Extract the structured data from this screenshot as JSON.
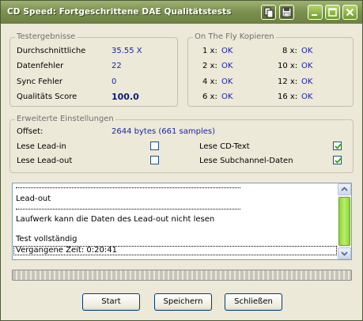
{
  "window": {
    "title": "CD Speed: Fortgeschrittene DAE Qualitätstests"
  },
  "results": {
    "legend": "Testergebnisse",
    "rows": [
      {
        "label": "Durchschnittliche",
        "value": "35.55 X"
      },
      {
        "label": "Datenfehler",
        "value": "22"
      },
      {
        "label": "Sync Fehler",
        "value": "0"
      },
      {
        "label": "Qualitäts Score",
        "value": "100.0"
      }
    ]
  },
  "onthefly": {
    "legend": "On The Fly Kopieren",
    "items": [
      {
        "speed": "1 x:",
        "status": "OK"
      },
      {
        "speed": "8 x:",
        "status": "OK"
      },
      {
        "speed": "2 x:",
        "status": "OK"
      },
      {
        "speed": "10 x:",
        "status": "OK"
      },
      {
        "speed": "4 x:",
        "status": "OK"
      },
      {
        "speed": "12 x:",
        "status": "OK"
      },
      {
        "speed": "6 x:",
        "status": "OK"
      },
      {
        "speed": "16 x:",
        "status": "OK"
      }
    ]
  },
  "advanced": {
    "legend": "Erweiterte Einstellungen",
    "offset_label": "Offset:",
    "offset_value": "2644 bytes (661 samples)",
    "options": [
      {
        "label": "Lese Lead-in",
        "checked": false
      },
      {
        "label": "Lese CD-Text",
        "checked": true
      },
      {
        "label": "Lese Lead-out",
        "checked": false
      },
      {
        "label": "Lese Subchannel-Daten",
        "checked": true
      }
    ]
  },
  "log": {
    "lines": [
      "Lead-out",
      "Laufwerk kann die Daten des Lead-out nicht lesen",
      "Test vollständig",
      "Vergangene Zeit:  0:20:41"
    ]
  },
  "progress": {
    "fraction": 0
  },
  "buttons": {
    "start": "Start",
    "save": "Speichern",
    "close": "Schließen"
  },
  "colors": {
    "titlebar": "#7d9150",
    "value_text": "#1a24a8",
    "scroll_thumb": "#8cd634"
  },
  "icons": [
    "app-icon",
    "copy-icon",
    "save-icon",
    "minimize-icon",
    "maximize-icon",
    "close-icon",
    "checkmark-icon",
    "arrow-up-icon",
    "arrow-down-icon"
  ]
}
